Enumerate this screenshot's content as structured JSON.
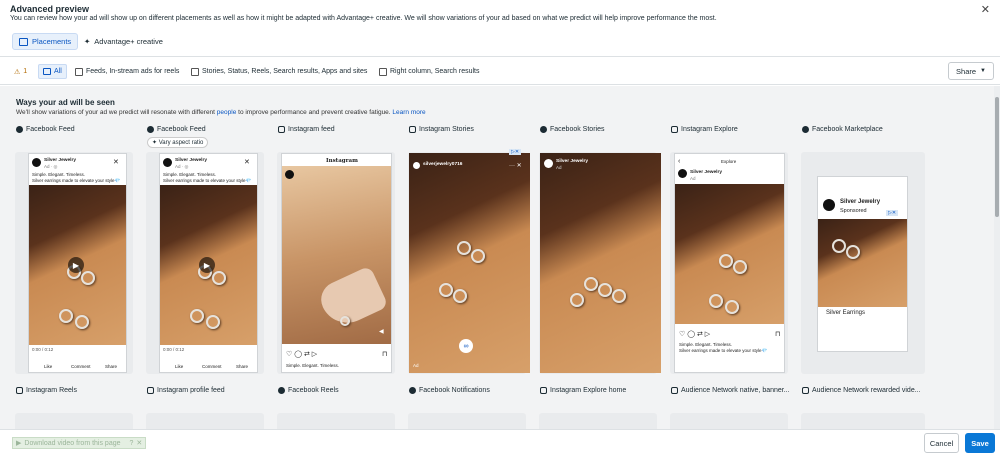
{
  "header": {
    "title": "Advanced preview",
    "description": "You can review how your ad will show up on different placements as well as how it might be adapted with Advantage+ creative. We will show variations of your ad based on what we predict will help improve performance the most.",
    "tabs": [
      {
        "label": "Placements",
        "active": true
      },
      {
        "label": "Advantage+ creative",
        "active": false
      }
    ]
  },
  "filters": {
    "warning_count": "1",
    "all_label": "All",
    "options": [
      "Feeds, In-stream ads for reels",
      "Stories, Status, Reels, Search results, Apps and sites",
      "Right column, Search results"
    ],
    "share_label": "Share"
  },
  "section": {
    "title": "Ways your ad will be seen",
    "desc_before": "We'll show variations of your ad we predict will resonate with different ",
    "desc_link": "people",
    "desc_after": " to improve performance and prevent creative fatigue. ",
    "learn_more": "Learn more"
  },
  "placements_row1": [
    "Facebook Feed",
    "Facebook Feed",
    "Instagram feed",
    "Instagram Stories",
    "Facebook Stories",
    "Instagram Explore",
    "Facebook Marketplace"
  ],
  "aspect_badge": "Vary aspect ratio",
  "placements_row2": [
    "Instagram Reels",
    "Instagram profile feed",
    "Facebook Reels",
    "Facebook Notifications",
    "Instagram Explore home",
    "Audience Network native, banner...",
    "Audience Network rewarded vide..."
  ],
  "ad": {
    "page_name": "Silver Jewelry",
    "sub": "Ad · ◎",
    "text1": "Simple. Elegant. Timeless.",
    "text2": "Silver earrings made to elevate your style💎",
    "time": "0:00 / 0:12",
    "like": "Like",
    "comment": "Comment",
    "share": "Share",
    "ig_logo": "Instagram",
    "story_handle": "silverjewelry0716",
    "story_ad": "Ad",
    "explore_title": "Explore",
    "marketplace_name": "Silver Jewelry",
    "marketplace_sponsored": "Sponsored",
    "marketplace_item": "Silver Earrings",
    "ig_caption": "Simple. Elegant. Timeless.",
    "ig_caption2": "Silver earrings made to elevate your style💎"
  },
  "footer": {
    "download_label": "Download video from this page",
    "cancel": "Cancel",
    "save": "Save"
  },
  "colors": {
    "accent": "#0a78d6",
    "link": "#0a56c2",
    "warning": "#b26a00"
  }
}
